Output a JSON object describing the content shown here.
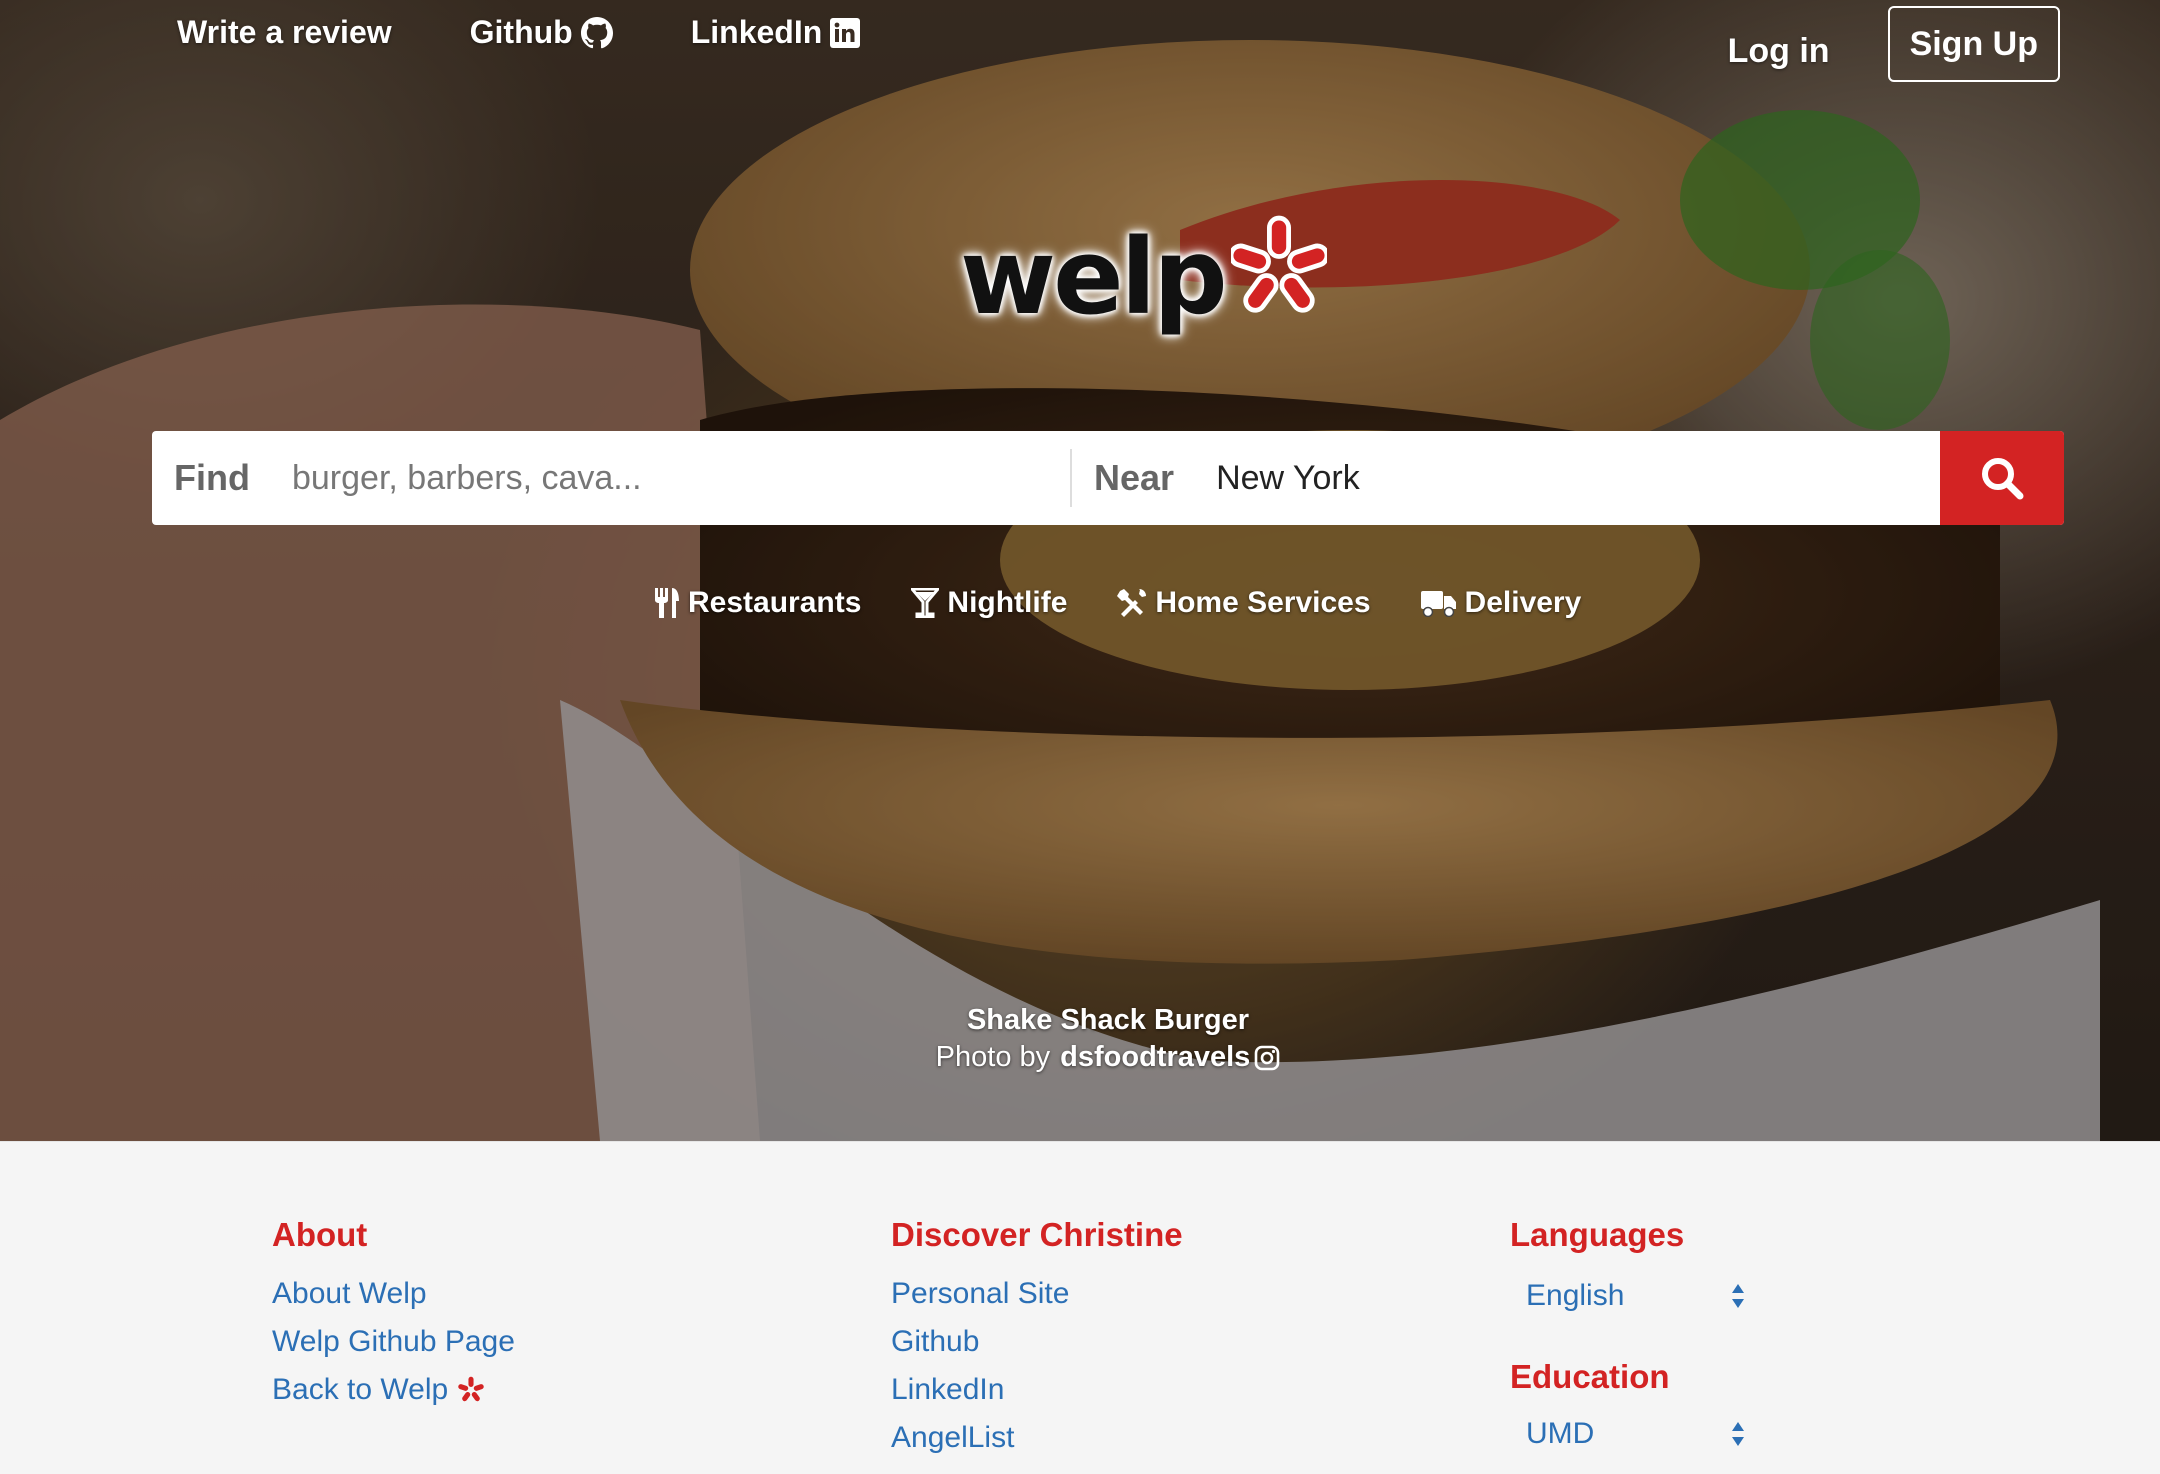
{
  "topnav": {
    "write_review": "Write a review",
    "github": "Github",
    "linkedin": "LinkedIn",
    "login": "Log in",
    "signup": "Sign Up"
  },
  "logo": {
    "text": "welp"
  },
  "search": {
    "find_label": "Find",
    "find_placeholder": "burger, barbers, cava...",
    "near_label": "Near",
    "near_value": "New York"
  },
  "categories": [
    {
      "label": "Restaurants",
      "icon": "fork-knife-icon"
    },
    {
      "label": "Nightlife",
      "icon": "cocktail-icon"
    },
    {
      "label": "Home Services",
      "icon": "tools-icon"
    },
    {
      "label": "Delivery",
      "icon": "truck-icon"
    }
  ],
  "caption": {
    "title": "Shake Shack Burger",
    "credit_prefix": "Photo by",
    "user": "dsfoodtravels"
  },
  "footer": {
    "about": {
      "heading": "About",
      "links": [
        "About Welp",
        "Welp Github Page",
        "Back to Welp"
      ]
    },
    "discover": {
      "heading": "Discover Christine",
      "links": [
        "Personal Site",
        "Github",
        "LinkedIn",
        "AngelList"
      ]
    },
    "languages": {
      "heading": "Languages",
      "value": "English"
    },
    "education": {
      "heading": "Education",
      "value": "UMD"
    }
  },
  "colors": {
    "brand_red": "#d32323",
    "link_blue": "#2b6fb5"
  }
}
